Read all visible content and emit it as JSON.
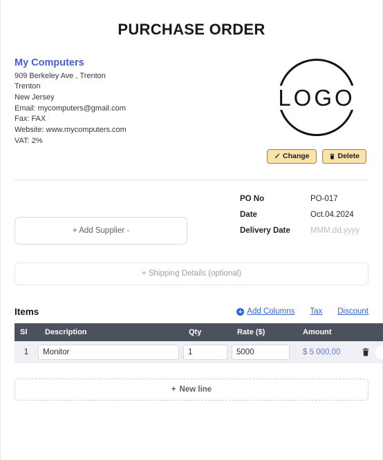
{
  "document": {
    "title": "PURCHASE ORDER"
  },
  "company": {
    "name": "My Computers",
    "lines": [
      "909 Berkeley Ave , Trenton",
      "Trenton",
      "New Jersey",
      "Email: mycomputers@gmail.com",
      "Fax: FAX",
      "Website: www.mycomputers.com",
      "VAT: 2%"
    ]
  },
  "logo": {
    "text": "LOGO",
    "change_label": "Change",
    "delete_label": "Delete",
    "change_icon": "pencil-icon",
    "delete_icon": "trash-icon",
    "button_bg": "#fae3ab",
    "button_border": "#9b8348"
  },
  "supplier": {
    "add_label": "+ Add Supplier -"
  },
  "po_meta": {
    "rows": [
      {
        "label": "PO No",
        "value": "PO-017",
        "is_placeholder": false
      },
      {
        "label": "Date",
        "value": "Oct.04.2024",
        "is_placeholder": false
      },
      {
        "label": "Delivery Date",
        "value": "MMM.dd.yyyy",
        "is_placeholder": true
      }
    ]
  },
  "shipping": {
    "label": "+ Shipping Details (optional)"
  },
  "items": {
    "title": "Items",
    "links": [
      {
        "label": "Add Columns",
        "icon": "plus-circle-icon"
      },
      {
        "label": "Tax",
        "icon": ""
      },
      {
        "label": "Discount",
        "icon": ""
      }
    ],
    "columns": [
      "Sl",
      "Description",
      "Qty",
      "Rate ($)",
      "Amount"
    ],
    "rows": [
      {
        "sl": "1",
        "description": "Monitor",
        "qty": "1",
        "rate": "5000",
        "amount": "$ 5 000,00"
      }
    ],
    "row_delete_icon": "trash-icon",
    "row_dropdown_icon": "chevron-down-icon",
    "new_line_label": "New line",
    "new_line_icon": "plus-icon",
    "header_bg": "#4b525e",
    "row_bg": "#eff0f3",
    "amount_color": "#6b72de",
    "link_color": "#2f63d8"
  }
}
